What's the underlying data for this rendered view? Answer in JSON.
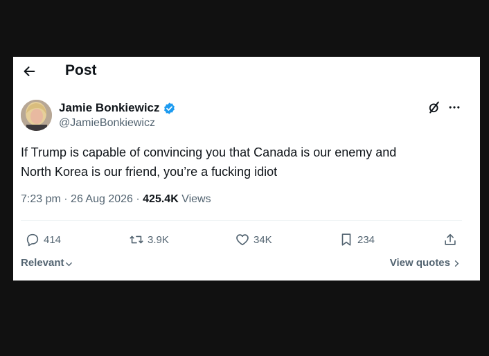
{
  "header": {
    "title": "Post",
    "back_icon": "arrow-left-icon"
  },
  "author": {
    "name": "Jamie Bonkiewicz",
    "handle": "@JamieBonkiewicz",
    "verified": true,
    "verified_color": "#1d9bf0"
  },
  "post": {
    "text_line1": "If Trump is capable of convincing you that Canada is our enemy and",
    "text_line2": "North Korea is our friend, you’re a fucking idiot",
    "time": "7:23 pm",
    "separator": "·",
    "date": "26 Aug 2026",
    "views_count": "425.4K",
    "views_label": "Views"
  },
  "actions": {
    "replies": "414",
    "reposts": "3.9K",
    "likes": "34K",
    "bookmarks": "234"
  },
  "footer": {
    "sort_label": "Relevant",
    "view_quotes_label": "View quotes"
  },
  "colors": {
    "background": "#111111",
    "card": "#ffffff",
    "text_primary": "#0f1419",
    "text_secondary": "#536471",
    "accent": "#1d9bf0"
  }
}
